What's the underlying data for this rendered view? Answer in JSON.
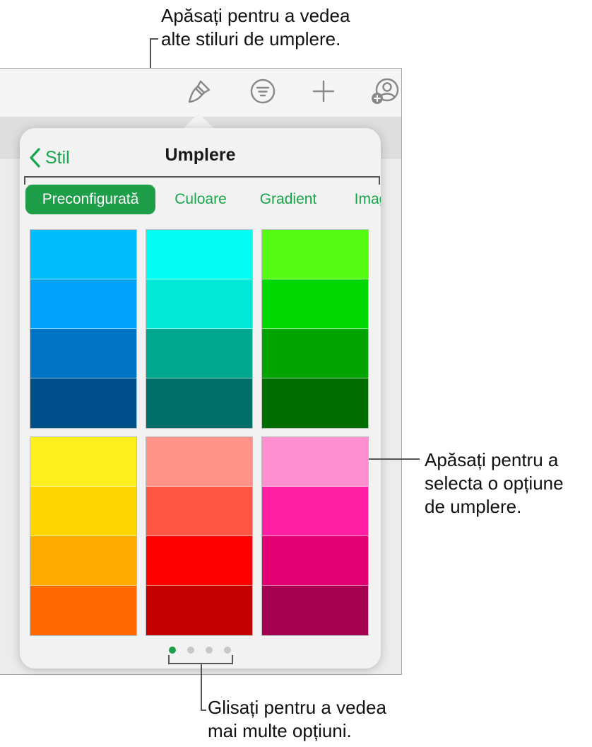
{
  "callouts": {
    "top": [
      "Apăsați pentru a vedea",
      "alte stiluri de umplere."
    ],
    "right": [
      "Apăsați pentru a",
      "selecta o opțiune",
      "de umplere."
    ],
    "bottom": [
      "Glisați pentru a vedea",
      "mai multe opțiuni."
    ]
  },
  "toolbar": {
    "icons": [
      "paintbrush-icon",
      "filter-icon",
      "plus-icon",
      "collaborate-icon"
    ]
  },
  "popover": {
    "back_label": "Stil",
    "title": "Umplere",
    "tabs": [
      "Preconfigurată",
      "Culoare",
      "Gradient",
      "Imagine"
    ],
    "active_tab": 0,
    "swatches": [
      [
        "#01bdfd",
        "#02a3fd",
        "#0073c4",
        "#004f8a"
      ],
      [
        "#03fdf2",
        "#02e8d6",
        "#00a78f",
        "#006f67"
      ],
      [
        "#56fb14",
        "#00d900",
        "#00a300",
        "#006d00"
      ],
      [
        "#fcef1d",
        "#ffd600",
        "#ffaa00",
        "#ff6a00"
      ],
      [
        "#ff938a",
        "#ff5544",
        "#ff0000",
        "#c30000"
      ],
      [
        "#fe90cf",
        "#fe1fa2",
        "#e30073",
        "#a3004f"
      ]
    ],
    "page_count": 4,
    "active_page": 0
  },
  "colors": {
    "accent": "#1f9e4a",
    "link": "#17a54a"
  }
}
